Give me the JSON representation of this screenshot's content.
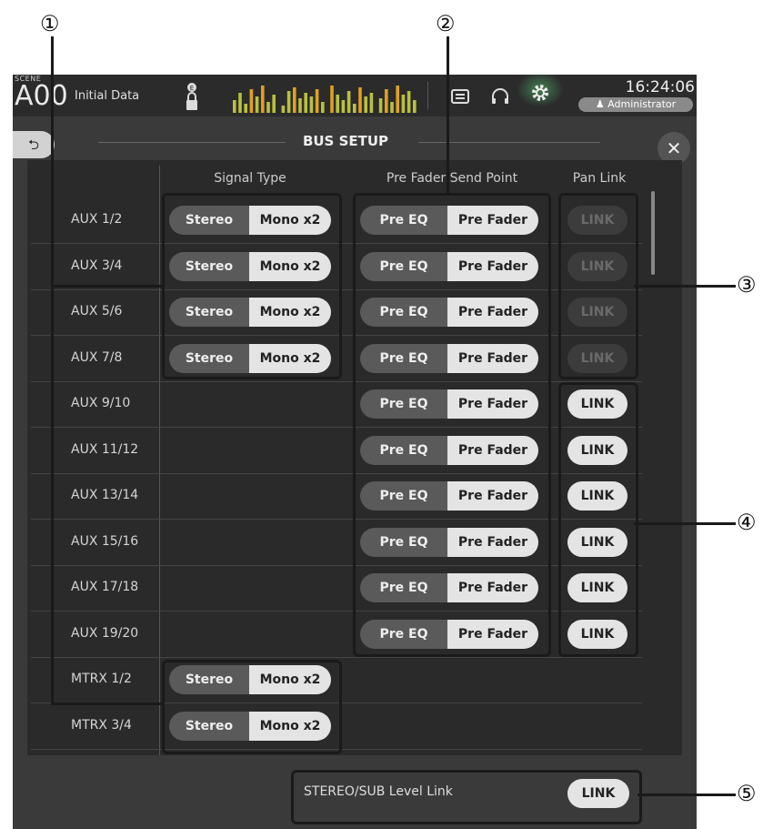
{
  "header": {
    "scene_small": "SCENE",
    "scene_number": "A00",
    "scene_name": "Initial Data",
    "time": "16:24:06",
    "user": "Administrator"
  },
  "dialog": {
    "title": "BUS SETUP",
    "back_glyph": "⮌",
    "close_glyph": "✕",
    "col_signal_type": "Signal Type",
    "col_pre_fader": "Pre Fader Send Point",
    "col_pan_link": "Pan Link"
  },
  "rows": [
    {
      "label": "AUX 1/2"
    },
    {
      "label": "AUX 3/4"
    },
    {
      "label": "AUX 5/6"
    },
    {
      "label": "AUX 7/8"
    },
    {
      "label": "AUX 9/10"
    },
    {
      "label": "AUX 11/12"
    },
    {
      "label": "AUX 13/14"
    },
    {
      "label": "AUX 15/16"
    },
    {
      "label": "AUX 17/18"
    },
    {
      "label": "AUX 19/20"
    },
    {
      "label": "MTRX 1/2"
    },
    {
      "label": "MTRX 3/4"
    }
  ],
  "labels": {
    "stereo": "Stereo",
    "mono": "Mono x2",
    "pre_eq": "Pre EQ",
    "pre_fader": "Pre Fader",
    "link": "LINK"
  },
  "footer": {
    "stereo_sub_label": "STEREO/SUB Level Link",
    "stereo_sub_button": "LINK"
  },
  "callouts": [
    "①",
    "②",
    "③",
    "④",
    "⑤"
  ],
  "colors": {
    "panel": "#3a3a3a",
    "inner": "#2a2a2a",
    "button_light": "#e4e4e4",
    "button_dark": "#5a5a5a",
    "glow": "#5ac878"
  }
}
